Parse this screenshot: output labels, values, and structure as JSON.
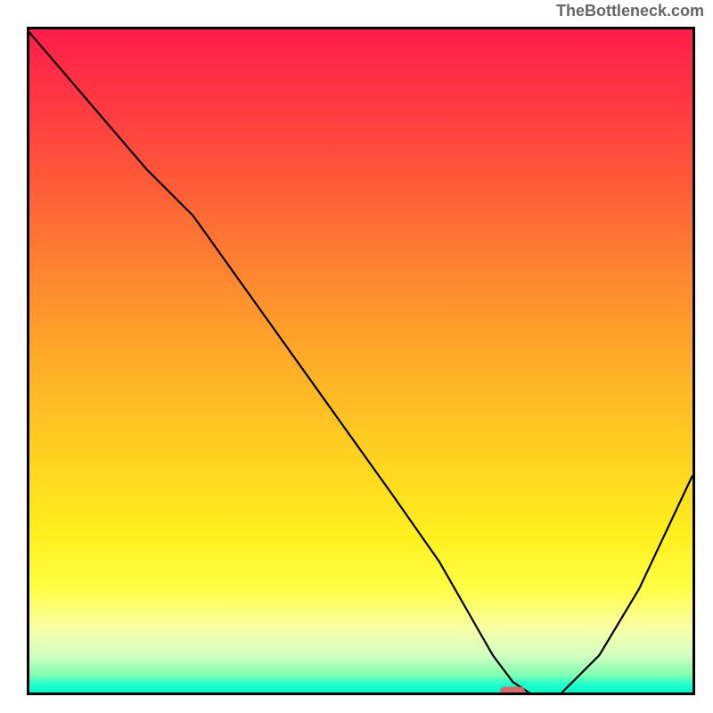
{
  "watermark": "TheBottleneck.com",
  "chart_data": {
    "type": "line",
    "title": "",
    "xlabel": "",
    "ylabel": "",
    "xlim": [
      0,
      100
    ],
    "ylim": [
      0,
      100
    ],
    "series": [
      {
        "name": "curve",
        "x": [
          0,
          18,
          25,
          35,
          45,
          55,
          62,
          66,
          70,
          73,
          76,
          80,
          86,
          92,
          100
        ],
        "values": [
          100,
          79,
          72,
          58,
          44,
          30,
          20,
          13,
          6,
          2,
          0,
          0,
          6,
          16,
          33
        ]
      }
    ],
    "marker": {
      "x": 73,
      "y": 0.5,
      "color": "#d66b6b"
    },
    "gradient": {
      "top": "#ff1d4a",
      "mid": "#ffd420",
      "bottom": "#00f5c5"
    },
    "grid": false,
    "legend": false
  }
}
